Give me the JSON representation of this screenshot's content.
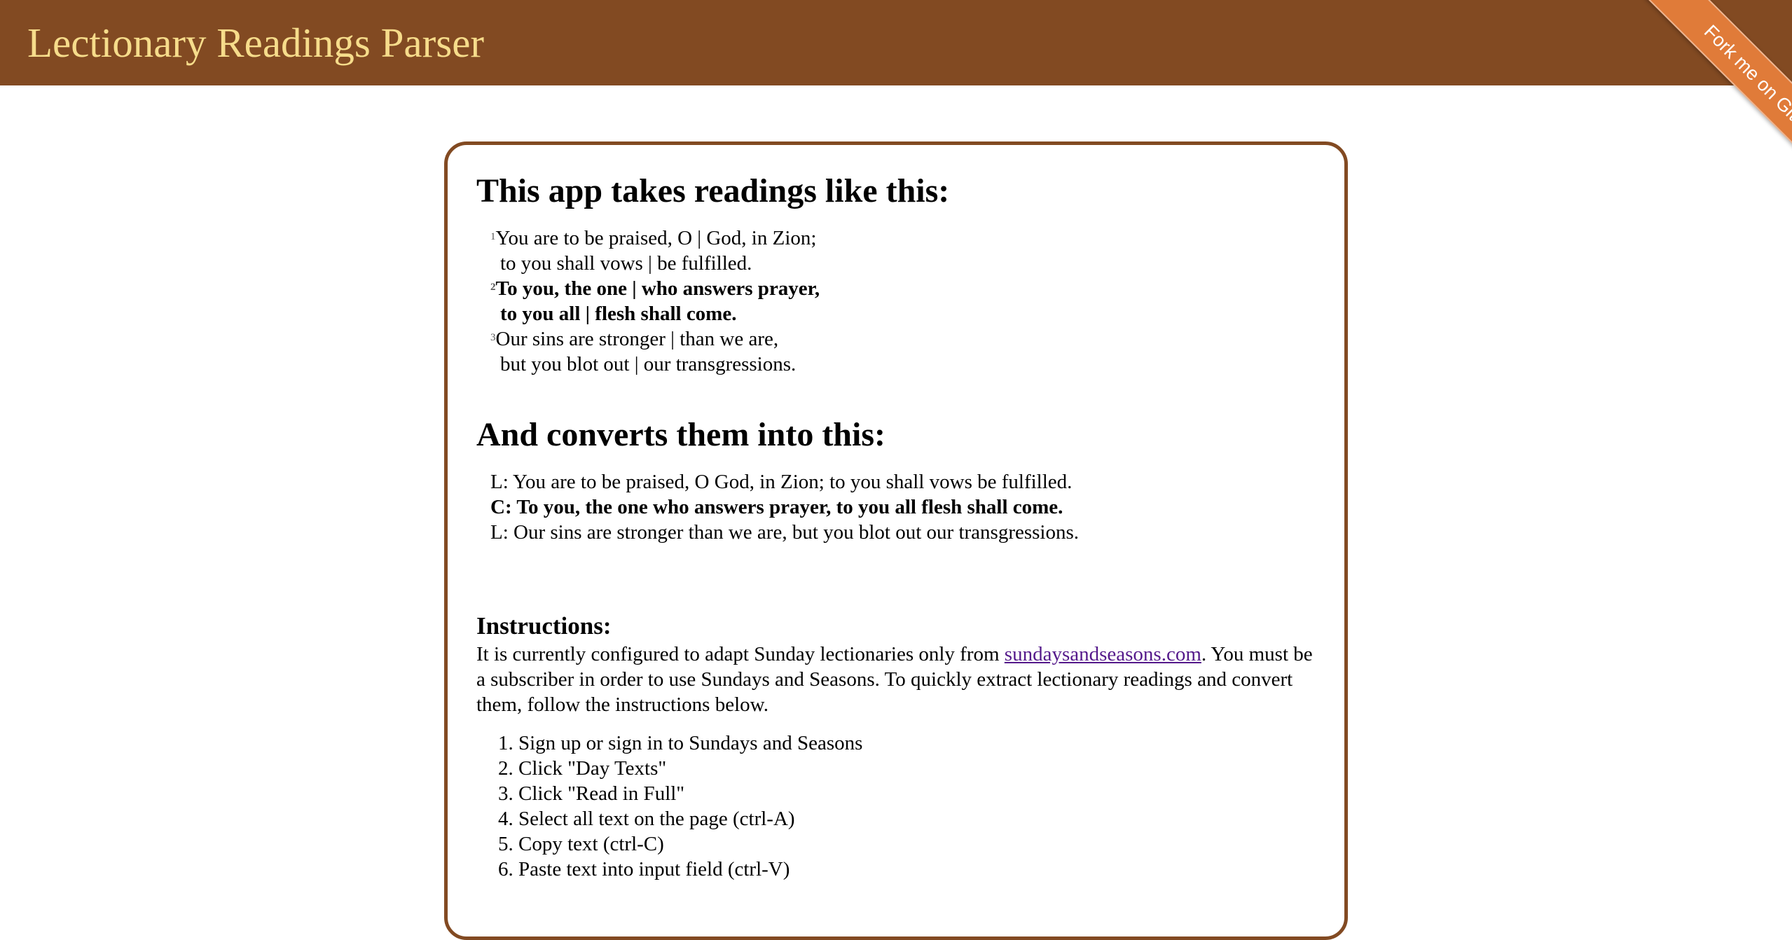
{
  "header": {
    "title": "Lectionary Readings Parser",
    "ribbon_label": "Fork me on GitHub",
    "background_color": "#824a22",
    "title_color": "#f6dc8b",
    "ribbon_color": "#e07b39"
  },
  "card": {
    "border_color": "#824a22"
  },
  "example_input": {
    "heading": "This app takes readings like this:",
    "lines": [
      {
        "verse": "1",
        "text": "You are to be praised, O | God, in Zion;",
        "bold": false
      },
      {
        "verse": "",
        "text": "to you shall vows | be fulfilled.",
        "bold": false
      },
      {
        "verse": "2",
        "text": "To you, the one | who answers prayer,",
        "bold": true
      },
      {
        "verse": "",
        "text": "to you all | flesh shall come.",
        "bold": true
      },
      {
        "verse": "3",
        "text": "Our sins are stronger | than we are,",
        "bold": false
      },
      {
        "verse": "",
        "text": "but you blot out | our transgressions.",
        "bold": false
      }
    ]
  },
  "example_output": {
    "heading": "And converts them into this:",
    "lines": [
      {
        "text": "L: You are to be praised, O God, in Zion; to you shall vows be fulfilled.",
        "bold": false
      },
      {
        "text": "C: To you, the one who answers prayer, to you all flesh shall come.",
        "bold": true
      },
      {
        "text": "L: Our sins are stronger than we are, but you blot out our transgressions.",
        "bold": false
      }
    ]
  },
  "instructions": {
    "heading": "Instructions:",
    "intro_before_link": "It is currently configured to adapt Sunday lectionaries only from ",
    "link_text": "sundaysandseasons.com",
    "intro_after_link": ". You must be a subscriber in order to use Sundays and Seasons. To quickly extract lectionary readings and convert them, follow the instructions below.",
    "steps": [
      "Sign up or sign in to Sundays and Seasons",
      "Click \"Day Texts\"",
      "Click \"Read in Full\"",
      "Select all text on the page (ctrl-A)",
      "Copy text (ctrl-C)",
      "Paste text into input field (ctrl-V)"
    ]
  }
}
